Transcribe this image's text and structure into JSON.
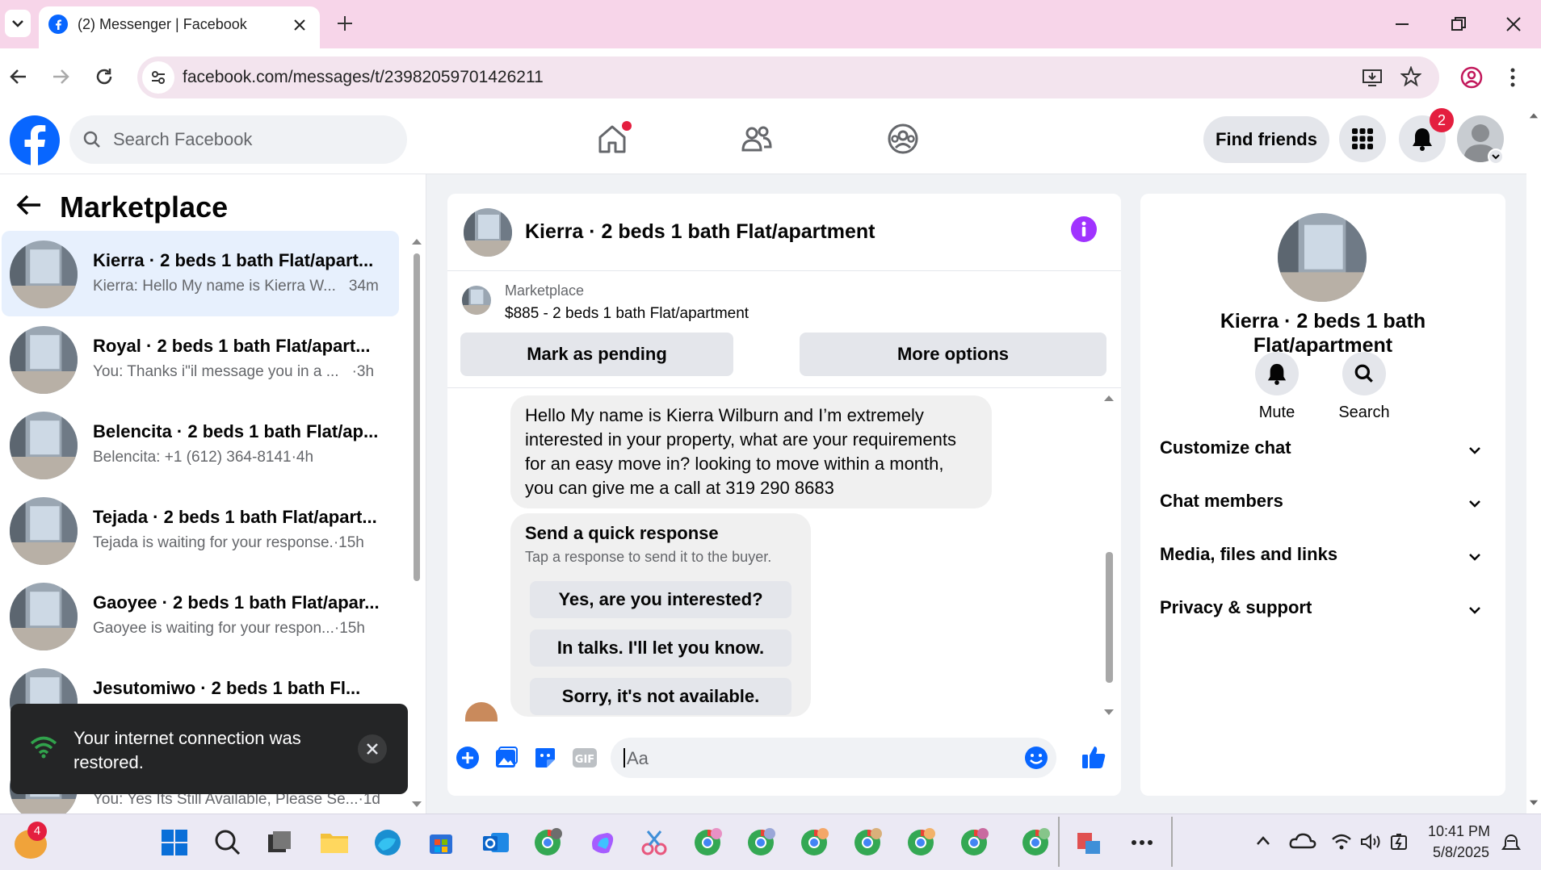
{
  "browser": {
    "tab_title": "(2) Messenger | Facebook",
    "url": "facebook.com/messages/t/23982059701426211"
  },
  "fb": {
    "search_placeholder": "Search Facebook",
    "find_friends": "Find friends",
    "notification_count": "2"
  },
  "sidebar": {
    "title": "Marketplace",
    "conversations": [
      {
        "name": "Kierra · 2 beds 1 bath Flat/apart...",
        "snippet": "Kierra: Hello My name is Kierra W...",
        "time": "34m"
      },
      {
        "name": "Royal · 2 beds 1 bath Flat/apart...",
        "snippet": "You: Thanks i\"il message you in a ...",
        "time": "·3h"
      },
      {
        "name": "Belencita · 2 beds 1 bath Flat/ap...",
        "snippet": "Belencita: +1 (612) 364-8141",
        "time": "·4h"
      },
      {
        "name": "Tejada · 2 beds 1 bath Flat/apart...",
        "snippet": "Tejada is waiting for your response.",
        "time": "·15h"
      },
      {
        "name": "Gaoyee · 2 beds 1 bath Flat/apar...",
        "snippet": "Gaoyee is waiting for your respon...",
        "time": "·15h"
      },
      {
        "name": "Jesutomiwo · 2 beds 1 bath Fl...",
        "snippet": "",
        "time": ""
      },
      {
        "name": "",
        "snippet": "You: Yes Its Still Available, Please Se...",
        "time": "·1d"
      }
    ]
  },
  "toast": {
    "message": "Your internet connection was restored."
  },
  "chat": {
    "title": "Kierra · 2 beds 1 bath Flat/apartment",
    "listing_category": "Marketplace",
    "listing_title": "$885 - 2 beds 1 bath Flat/apartment",
    "mark_pending": "Mark as pending",
    "more_options": "More options",
    "message": "Hello My name is Kierra Wilburn  and I’m extremely interested in your property, what are your requirements for an easy move in? looking to move within a month, you can give me a call at 319 290 8683",
    "quick_title": "Send a quick response",
    "quick_sub": "Tap a response to send it to the buyer.",
    "quick_responses": [
      "Yes, are you interested?",
      "In talks. I'll let you know.",
      "Sorry, it's not available."
    ],
    "composer_placeholder": "Aa"
  },
  "details": {
    "title_line1": "Kierra · 2 beds 1 bath",
    "title_line2": "Flat/apartment",
    "mute": "Mute",
    "search": "Search",
    "sections": [
      "Customize chat",
      "Chat members",
      "Media, files and links",
      "Privacy & support"
    ]
  },
  "taskbar": {
    "badge": "4",
    "time": "10:41 PM",
    "date": "5/8/2025"
  },
  "colors": {
    "fb_blue": "#0866ff",
    "accent_purple": "#a033ff",
    "active_row": "#e7f0fd",
    "tab_bar": "#f7d5e9"
  }
}
